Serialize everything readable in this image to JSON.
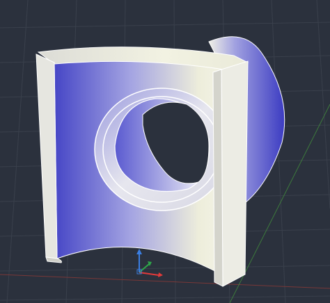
{
  "viewport": {
    "background": "#2b313d",
    "grid_color": "#3a404c",
    "grid_axis_x_color": "#7a3838",
    "grid_axis_y_color": "#3d7a3d"
  },
  "model": {
    "object": "cylindrical-shell-segment-with-bore",
    "solid_color": "#e8e8e2",
    "shade_dark": "#4a4ac8",
    "shade_light": "#f6f6ea"
  },
  "ucs_icon": {
    "x_axis_color": "#e23a3a",
    "y_axis_color": "#2ea84a",
    "z_axis_color": "#3a7ee2"
  }
}
